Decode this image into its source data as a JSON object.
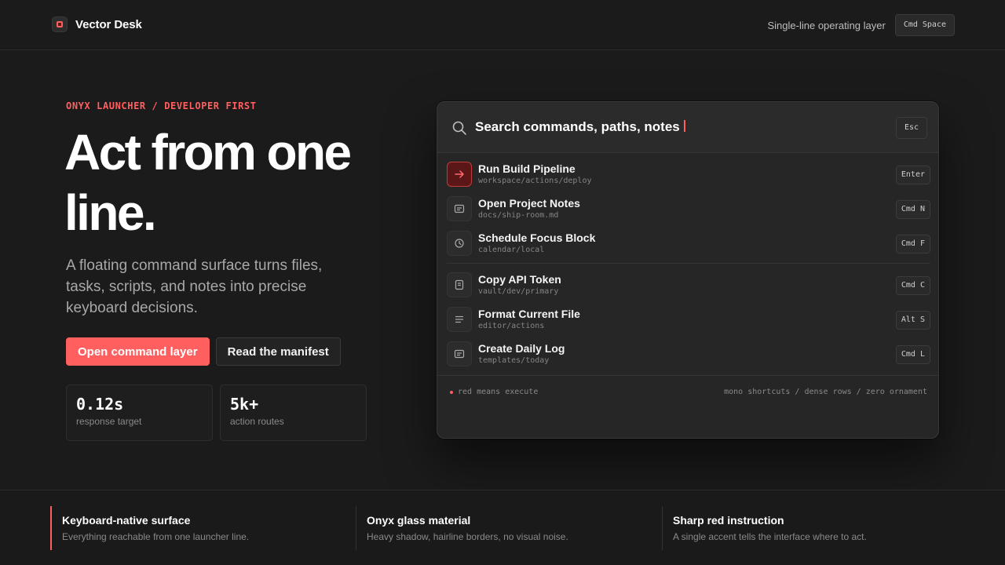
{
  "header": {
    "brand": "Vector Desk",
    "tagline": "Single-line operating layer",
    "shortcut": "Cmd Space"
  },
  "hero": {
    "eyebrow": "ONYX LAUNCHER / DEVELOPER FIRST",
    "headline": "Act from one line.",
    "subcopy": "A floating command surface turns files, tasks, scripts, and notes into precise keyboard decisions.",
    "primary_cta": "Open command layer",
    "secondary_cta": "Read the manifest",
    "stats": [
      {
        "value": "0.12s",
        "label": "response target"
      },
      {
        "value": "5k+",
        "label": "action routes"
      }
    ]
  },
  "launcher": {
    "search_text": "Search commands, paths, notes",
    "search_shortcut": "Esc",
    "commands": [
      {
        "title": "Run Build Pipeline",
        "path": "workspace/actions/deploy",
        "shortcut": "Enter",
        "icon": "arrow-right-icon",
        "active": true
      },
      {
        "title": "Open Project Notes",
        "path": "docs/ship-room.md",
        "shortcut": "Cmd N",
        "icon": "note-icon"
      },
      {
        "title": "Schedule Focus Block",
        "path": "calendar/local",
        "shortcut": "Cmd F",
        "icon": "clock-icon"
      },
      {
        "title": "Copy API Token",
        "path": "vault/dev/primary",
        "shortcut": "Cmd C",
        "icon": "document-icon"
      },
      {
        "title": "Format Current File",
        "path": "editor/actions",
        "shortcut": "Alt S",
        "icon": "align-lines-icon"
      },
      {
        "title": "Create Daily Log",
        "path": "templates/today",
        "shortcut": "Cmd L",
        "icon": "note-icon"
      }
    ],
    "footer_left": "red means execute",
    "footer_right": "mono shortcuts / dense rows / zero ornament"
  },
  "features": [
    {
      "title": "Keyboard-native surface",
      "desc": "Everything reachable from one launcher line."
    },
    {
      "title": "Onyx glass material",
      "desc": "Heavy shadow, hairline borders, no visual noise."
    },
    {
      "title": "Sharp red instruction",
      "desc": "A single accent tells the interface where to act."
    }
  ],
  "colors": {
    "accent": "#ff5f5f",
    "background": "#1b1b1b",
    "panel": "#262626"
  }
}
